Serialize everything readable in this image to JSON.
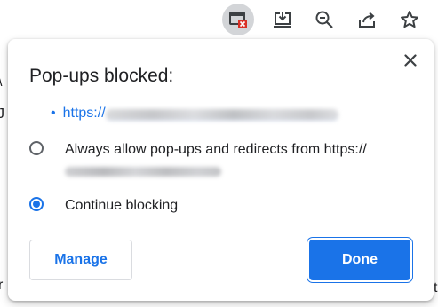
{
  "toolbar": {
    "buttons": [
      {
        "icon": "popup-blocked-icon",
        "active": true
      },
      {
        "icon": "install-app-icon",
        "active": false
      },
      {
        "icon": "zoom-out-icon",
        "active": false
      },
      {
        "icon": "share-icon",
        "active": false
      },
      {
        "icon": "bookmark-star-icon",
        "active": false
      }
    ]
  },
  "page_fragments": {
    "left_top": "\\",
    "left_middle": "J",
    "left_bottom": "r",
    "right_bottom": "t"
  },
  "popup": {
    "title": "Pop-ups blocked:",
    "close_icon": "close-icon",
    "blocked_url": {
      "bullet": "•",
      "prefix": "https://"
    },
    "options": {
      "allow_label": "Always allow pop-ups and redirects from https://",
      "block_label": "Continue blocking",
      "selected": "block"
    },
    "buttons": {
      "manage": "Manage",
      "done": "Done"
    }
  },
  "colors": {
    "accent": "#1a73e8",
    "text": "#202124",
    "active_icon_bg": "#d3d5d8",
    "blocked_badge": "#d93025"
  }
}
